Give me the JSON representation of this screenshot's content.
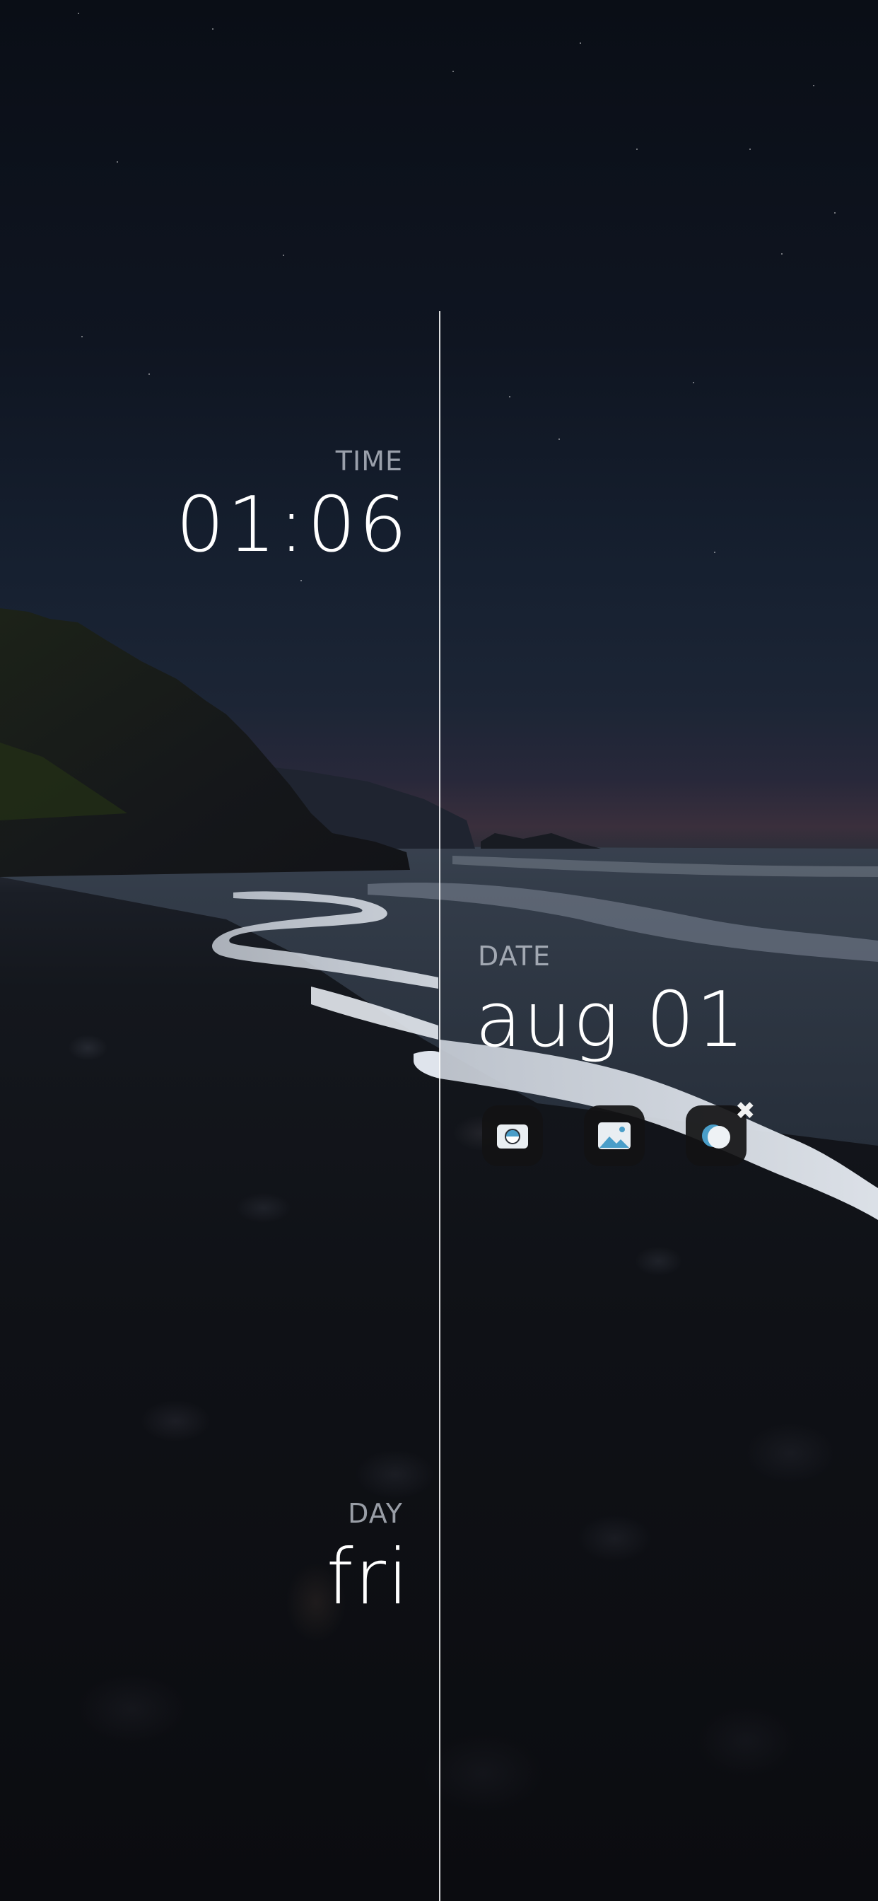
{
  "time": {
    "label": "TIME",
    "value": "01:06"
  },
  "date": {
    "label": "DATE",
    "value": "aug 01"
  },
  "day": {
    "label": "DAY",
    "value": "fri"
  },
  "shortcuts": [
    {
      "icon": "camera-icon"
    },
    {
      "icon": "gallery-icon"
    },
    {
      "icon": "theme-toggle-icon"
    }
  ],
  "close_symbol": "✖",
  "colors": {
    "accent": "#4a9ec9",
    "text": "#ffffff",
    "label": "#c8cdd7"
  }
}
